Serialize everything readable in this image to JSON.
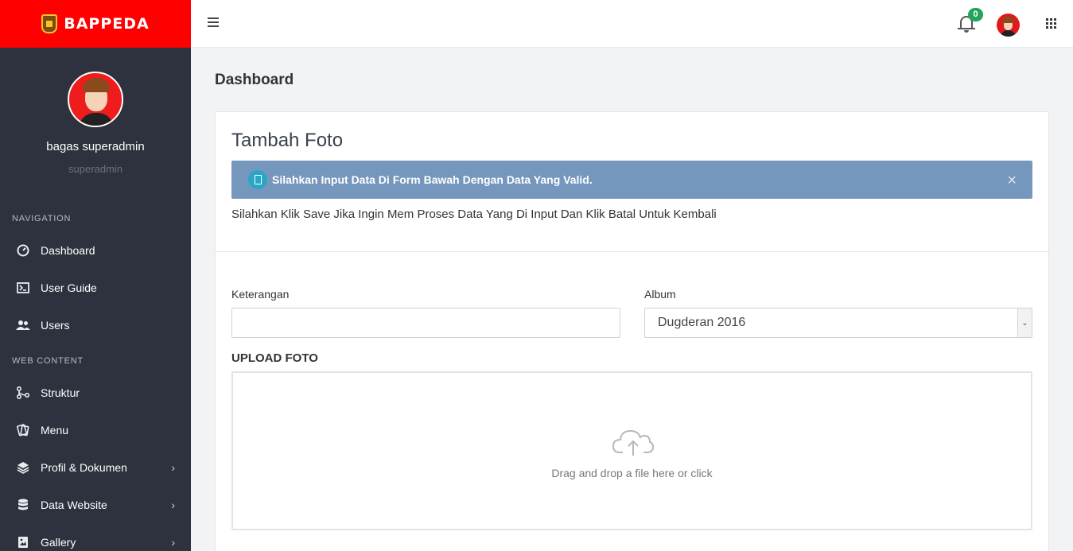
{
  "brand": {
    "name": "BAPPEDA",
    "color": "#fe0000"
  },
  "user": {
    "name": "bagas superadmin",
    "role": "superadmin"
  },
  "sidebar": {
    "section_navigation": "NAVIGATION",
    "section_web_content": "WEB CONTENT",
    "items": [
      {
        "label": "Dashboard",
        "icon": "gauge-icon"
      },
      {
        "label": "User Guide",
        "icon": "terminal-icon"
      },
      {
        "label": "Users",
        "icon": "users-icon"
      },
      {
        "label": "Struktur",
        "icon": "hierarchy-icon"
      },
      {
        "label": "Menu",
        "icon": "cards-icon"
      },
      {
        "label": "Profil & Dokumen",
        "icon": "layers-icon",
        "has_submenu": true
      },
      {
        "label": "Data Website",
        "icon": "database-icon",
        "has_submenu": true
      },
      {
        "label": "Gallery",
        "icon": "image-icon",
        "has_submenu": true
      }
    ]
  },
  "header": {
    "notification_count": "0"
  },
  "page": {
    "title": "Dashboard"
  },
  "card": {
    "title": "Tambah Foto",
    "alert": "Silahkan Input Data Di Form Bawah Dengan Data Yang Valid.",
    "alert_close": "×",
    "help_text": "Silahkan Klik Save Jika Ingin Mem Proses Data Yang Di Input Dan Klik Batal Untuk Kembali"
  },
  "form": {
    "keterangan_label": "Keterangan",
    "keterangan_value": "",
    "album_label": "Album",
    "album_selected": "Dugderan 2016",
    "upload_label": "UPLOAD FOTO",
    "dropzone_text": "Drag and drop a file here or click"
  }
}
